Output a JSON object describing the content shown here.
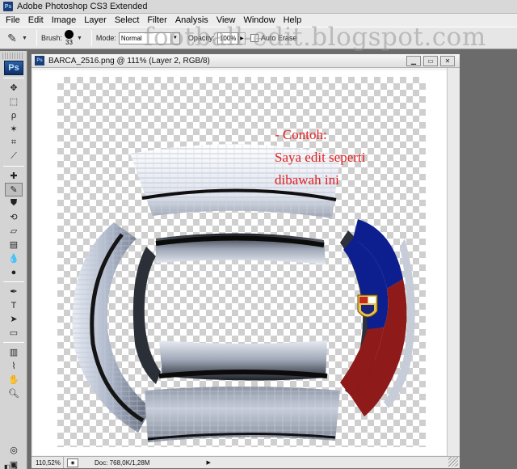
{
  "window": {
    "title": "Adobe Photoshop CS3 Extended",
    "app_icon": "Ps"
  },
  "menu": [
    "File",
    "Edit",
    "Image",
    "Layer",
    "Select",
    "Filter",
    "Analysis",
    "View",
    "Window",
    "Help"
  ],
  "options": {
    "brush_label": "Brush:",
    "brush_size": "33",
    "mode_label": "Mode:",
    "mode_value": "Normal",
    "opacity_label": "Opacity:",
    "opacity_value": "100%",
    "auto_erase_label": "Auto Erase"
  },
  "watermark": "football-edit.blogspot.com",
  "toolbox": {
    "logo": "Ps",
    "foreground_color": "#7e1414",
    "background_color": "#ffffff"
  },
  "document": {
    "title": "BARCA_2516.png @ 111% (Layer 2, RGB/8)",
    "zoom": "110,52%",
    "doc_info": "Doc: 768,0K/1,28M"
  },
  "annotation": {
    "line1": "- Contoh:",
    "line2": "Saya edit seperti",
    "line3": "dibawah ini"
  },
  "colors": {
    "annotation_red": "#e21f1f",
    "barca_blue": "#0d1f8f",
    "barca_red": "#8e1a1a"
  }
}
